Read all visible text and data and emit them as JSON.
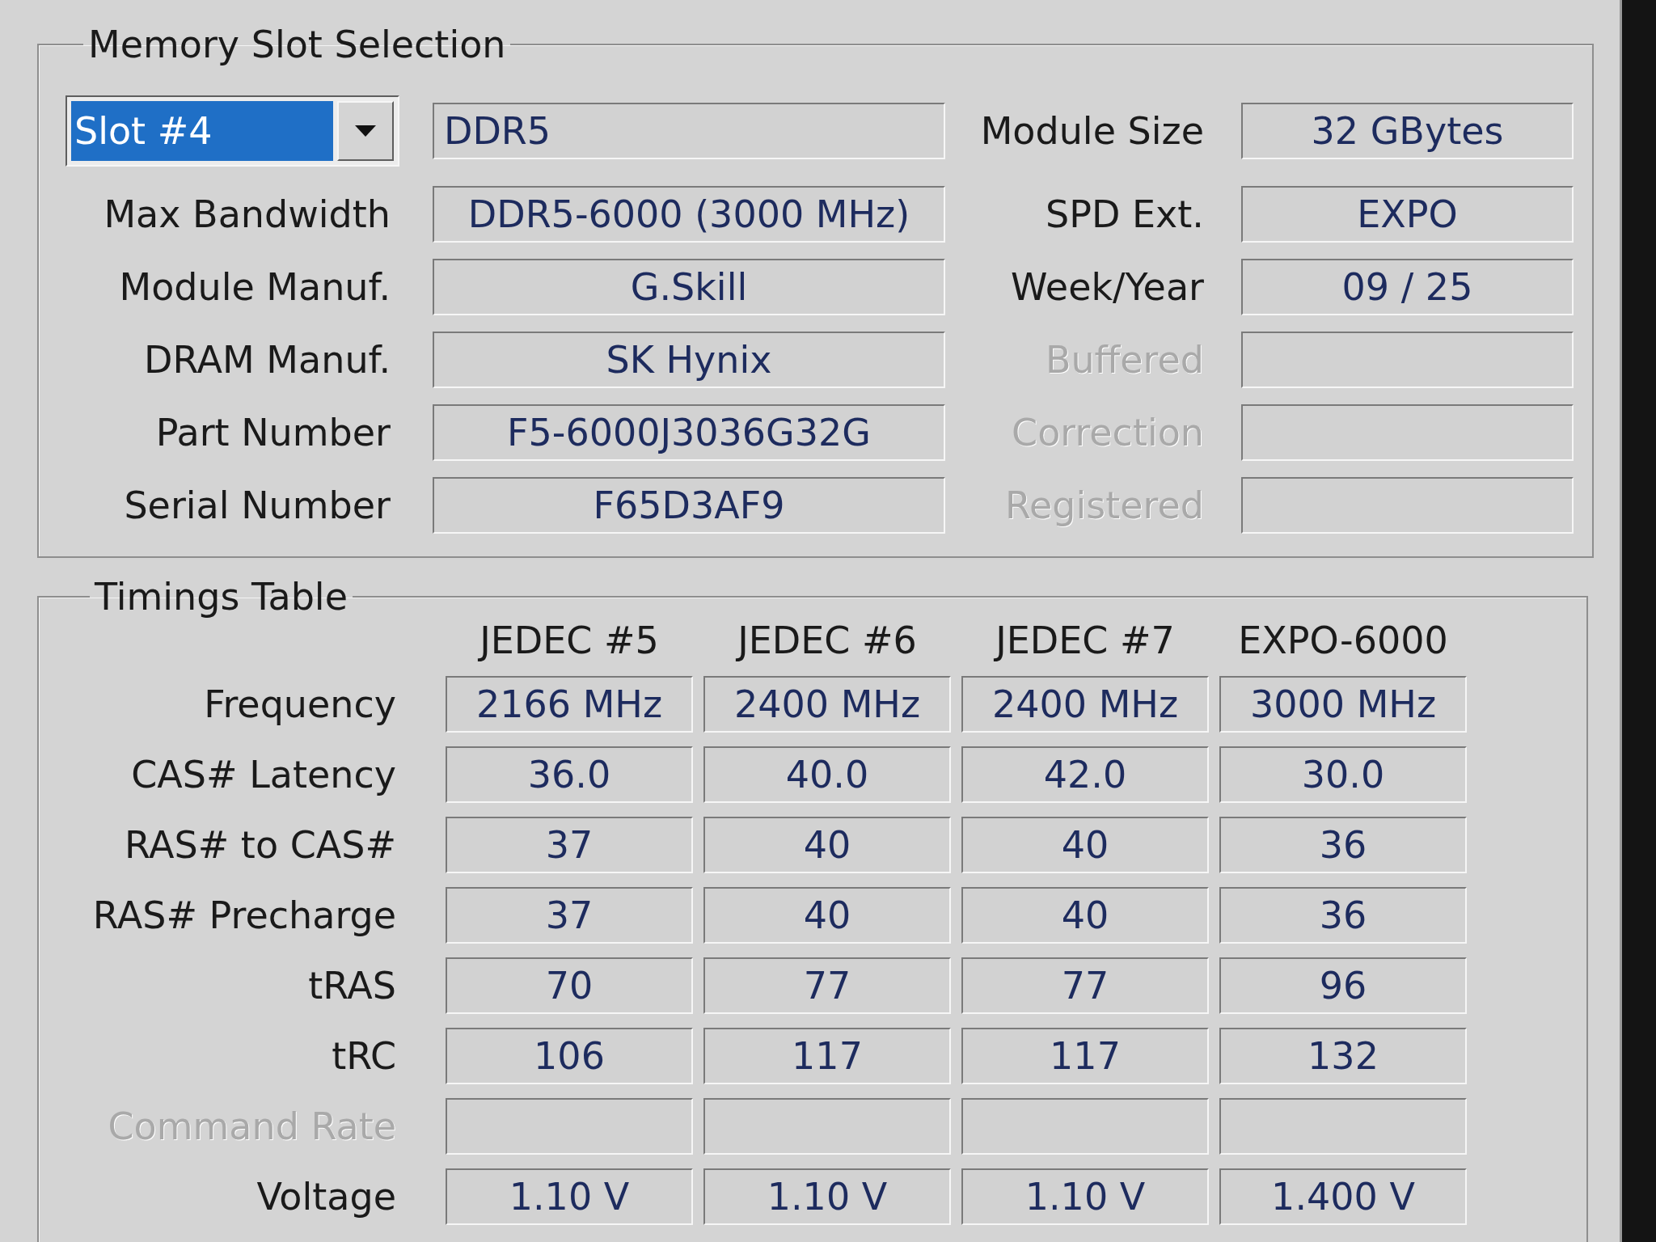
{
  "slot_selection": {
    "title": "Memory Slot Selection",
    "slot": {
      "value": "Slot #4",
      "focused": true
    },
    "memory_type": "DDR5",
    "left_fields": [
      {
        "label": "Max Bandwidth",
        "value": "DDR5-6000 (3000 MHz)"
      },
      {
        "label": "Module Manuf.",
        "value": "G.Skill"
      },
      {
        "label": "DRAM Manuf.",
        "value": "SK Hynix"
      },
      {
        "label": "Part Number",
        "value": "F5-6000J3036G32G"
      },
      {
        "label": "Serial Number",
        "value": "F65D3AF9"
      }
    ],
    "right_fields": [
      {
        "label": "Module Size",
        "value": "32 GBytes",
        "disabled": false
      },
      {
        "label": "SPD Ext.",
        "value": "EXPO",
        "disabled": false
      },
      {
        "label": "Week/Year",
        "value": "09 / 25",
        "disabled": false
      },
      {
        "label": "Buffered",
        "disabled": true
      },
      {
        "label": "Correction",
        "disabled": true
      },
      {
        "label": "Registered",
        "disabled": true
      }
    ]
  },
  "timings": {
    "title": "Timings Table",
    "columns": [
      "JEDEC #5",
      "JEDEC #6",
      "JEDEC #7",
      "EXPO-6000"
    ],
    "rows": [
      {
        "label": "Frequency",
        "disabled": false,
        "values": [
          "2166 MHz",
          "2400 MHz",
          "2400 MHz",
          "3000 MHz"
        ]
      },
      {
        "label": "CAS# Latency",
        "disabled": false,
        "values": [
          "36.0",
          "40.0",
          "42.0",
          "30.0"
        ]
      },
      {
        "label": "RAS# to CAS#",
        "disabled": false,
        "values": [
          "37",
          "40",
          "40",
          "36"
        ]
      },
      {
        "label": "RAS# Precharge",
        "disabled": false,
        "values": [
          "37",
          "40",
          "40",
          "36"
        ]
      },
      {
        "label": "tRAS",
        "disabled": false,
        "values": [
          "70",
          "77",
          "77",
          "96"
        ]
      },
      {
        "label": "tRC",
        "disabled": false,
        "values": [
          "106",
          "117",
          "117",
          "132"
        ]
      },
      {
        "label": "Command Rate",
        "disabled": true
      },
      {
        "label": "Voltage",
        "disabled": false,
        "values": [
          "1.10 V",
          "1.10 V",
          "1.10 V",
          "1.400 V"
        ]
      }
    ]
  }
}
